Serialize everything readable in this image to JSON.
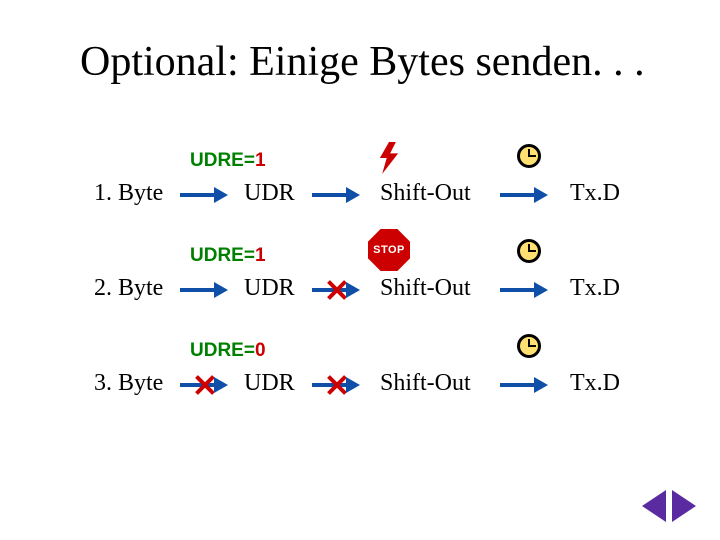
{
  "title": "Optional: Einige Bytes senden. . .",
  "labels": {
    "byte": "Byte",
    "udr": "UDR",
    "shift_out": "Shift-Out",
    "txd": "Tx.D",
    "udre": "UDRE=",
    "stop": "STOP"
  },
  "rows": [
    {
      "index": "1.",
      "udre_value": "1",
      "arrow1_blocked": false,
      "arrow2_blocked": false,
      "mid_icon": "lightning"
    },
    {
      "index": "2.",
      "udre_value": "1",
      "arrow1_blocked": false,
      "arrow2_blocked": true,
      "mid_icon": "stop"
    },
    {
      "index": "3.",
      "udre_value": "0",
      "arrow1_blocked": true,
      "arrow2_blocked": true,
      "mid_icon": null
    }
  ]
}
